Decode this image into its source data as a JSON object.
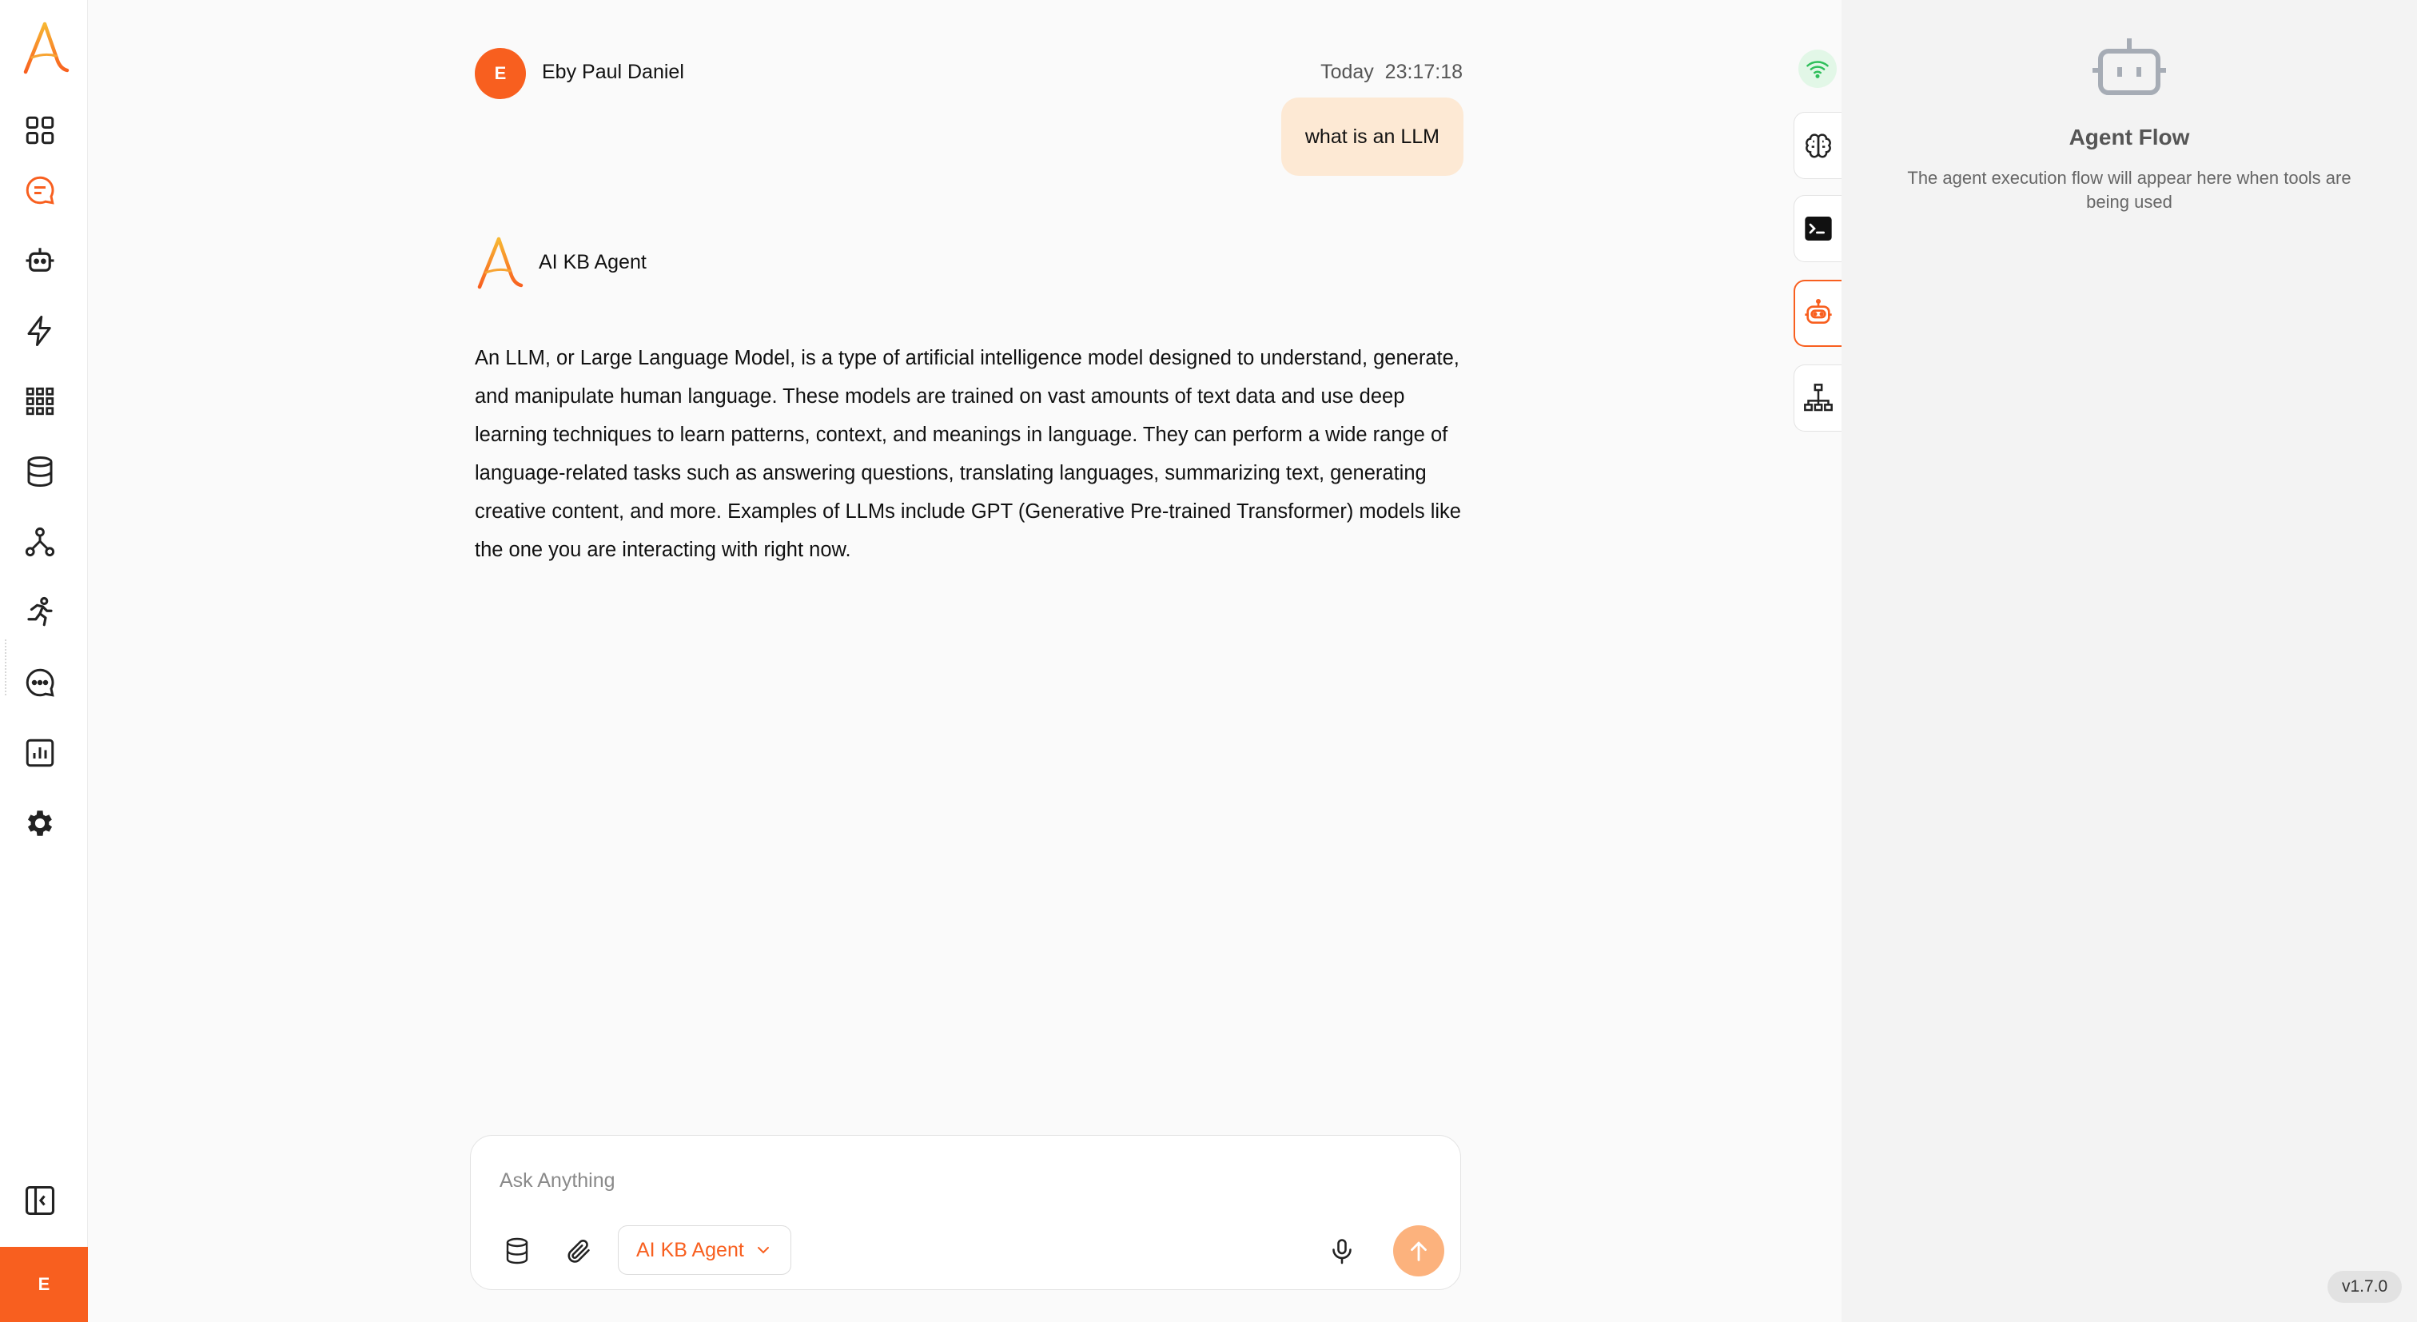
{
  "sidebar": {
    "brand_icon": "brand-a-logo-icon",
    "items": [
      {
        "icon": "grid-dashboard-icon"
      },
      {
        "icon": "chat-icon",
        "active": true
      },
      {
        "icon": "robot-icon"
      },
      {
        "icon": "lightning-icon"
      },
      {
        "icon": "apps-grid-icon"
      },
      {
        "icon": "database-icon"
      },
      {
        "icon": "workflow-icon"
      },
      {
        "icon": "running-icon"
      },
      {
        "icon": "message-dots-icon"
      },
      {
        "icon": "bar-chart-icon"
      },
      {
        "icon": "gear-icon"
      }
    ],
    "collapse_icon": "sidebar-collapse-icon",
    "user_initial": "E"
  },
  "conversation": {
    "user": {
      "initial": "E",
      "name": "Eby Paul Daniel",
      "timestamp": "Today  23:17:18",
      "message": "what is an LLM"
    },
    "agent": {
      "name": "AI KB Agent",
      "response": "An LLM, or Large Language Model, is a type of artificial intelligence model designed to understand, generate, and manipulate human language. These models are trained on vast amounts of text data and use deep learning techniques to learn patterns, context, and meanings in language. They can perform a wide range of language-related tasks such as answering questions, translating languages, summarizing text, generating creative content, and more. Examples of LLMs include GPT (Generative Pre-trained Transformer) models like the one you are interacting with right now."
    }
  },
  "composer": {
    "placeholder": "Ask Anything",
    "agent_selector": "AI KB Agent"
  },
  "tool_rail": {
    "status_icon": "wifi-connected-icon",
    "tabs": [
      {
        "icon": "brain-icon"
      },
      {
        "icon": "terminal-icon"
      },
      {
        "icon": "robot-icon",
        "active": true
      },
      {
        "icon": "hierarchy-icon"
      }
    ]
  },
  "agent_panel": {
    "title": "Agent Flow",
    "description": "The agent execution flow will appear here when tools are being used"
  },
  "version": "v1.7.0",
  "colors": {
    "accent": "#f85f1f",
    "user_bubble": "#fde9d4",
    "send_button": "#fcb27d",
    "status_green": "#2fbf5b"
  }
}
